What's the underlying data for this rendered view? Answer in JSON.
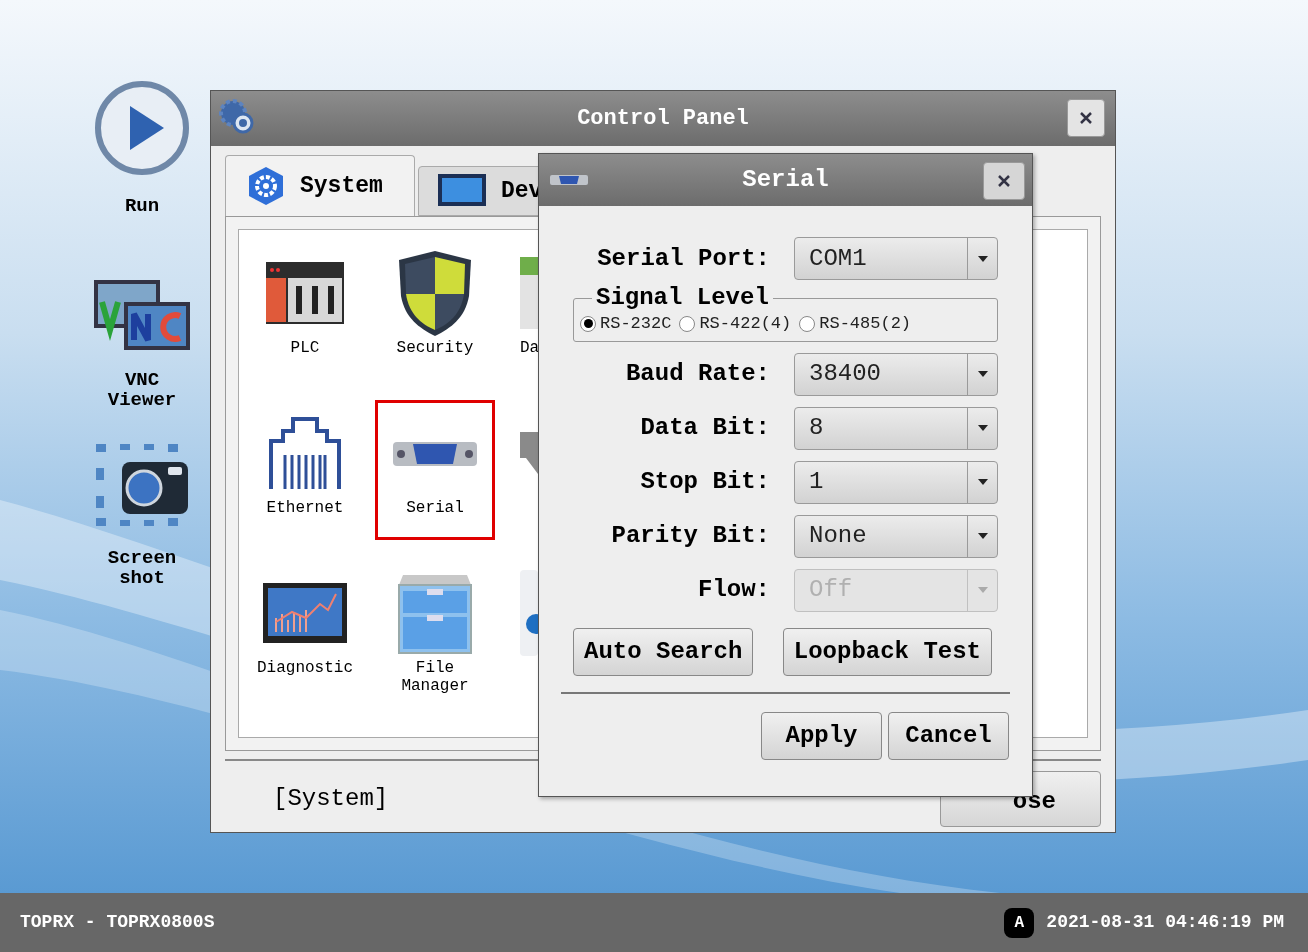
{
  "desktop_shortcuts": [
    {
      "kind": "play",
      "label": "Run"
    },
    {
      "kind": "vnc",
      "label": "VNC Viewer"
    },
    {
      "kind": "camera",
      "label": "Screen shot"
    }
  ],
  "control_panel": {
    "title": "Control Panel",
    "tabs": [
      {
        "kind": "gear",
        "label": "System",
        "selected": true
      },
      {
        "kind": "monitor",
        "label": "Dev",
        "selected": false
      }
    ],
    "items": [
      {
        "kind": "plc",
        "label": "PLC",
        "highlighted": false
      },
      {
        "kind": "shield",
        "label": "Security",
        "highlighted": false
      },
      {
        "kind": "partial-green",
        "label": "Da",
        "highlighted": false
      },
      {
        "kind": "ethernet",
        "label": "Ethernet",
        "highlighted": false
      },
      {
        "kind": "serial",
        "label": "Serial",
        "highlighted": true
      },
      {
        "kind": "partial-gray",
        "highlighted": false
      },
      {
        "kind": "chart",
        "label": "Diagnostic",
        "highlighted": false
      },
      {
        "kind": "cabinet",
        "label": "File Manager",
        "highlighted": false
      },
      {
        "kind": "partial-blue",
        "highlighted": false
      }
    ],
    "status": "[System]",
    "close_button": "ose"
  },
  "serial_dialog": {
    "title": "Serial",
    "fields": [
      {
        "kind": "combo",
        "label": "Serial Port:",
        "value": "COM1",
        "disabled": false
      },
      {
        "kind": "radio_group",
        "legend": "Signal Level",
        "options": [
          {
            "label": "RS-232C",
            "selected": true
          },
          {
            "label": "RS-422(4)",
            "selected": false
          },
          {
            "label": "RS-485(2)",
            "selected": false
          }
        ]
      },
      {
        "kind": "combo",
        "label": "Baud Rate:",
        "value": "38400",
        "disabled": false
      },
      {
        "kind": "combo",
        "label": "Data Bit:",
        "value": "8",
        "disabled": false
      },
      {
        "kind": "combo",
        "label": "Stop Bit:",
        "value": "1",
        "disabled": false
      },
      {
        "kind": "combo",
        "label": "Parity Bit:",
        "value": "None",
        "disabled": false
      },
      {
        "kind": "combo",
        "label": "Flow:",
        "value": "Off",
        "disabled": true
      }
    ],
    "tool_buttons": [
      "Auto Search",
      "Loopback Test"
    ],
    "buttons": [
      "Apply",
      "Cancel"
    ]
  },
  "taskbar": {
    "device": "TOPRX - TOPRX0800S",
    "input_mode": "A",
    "datetime": "2021-08-31 04:46:19 PM"
  }
}
